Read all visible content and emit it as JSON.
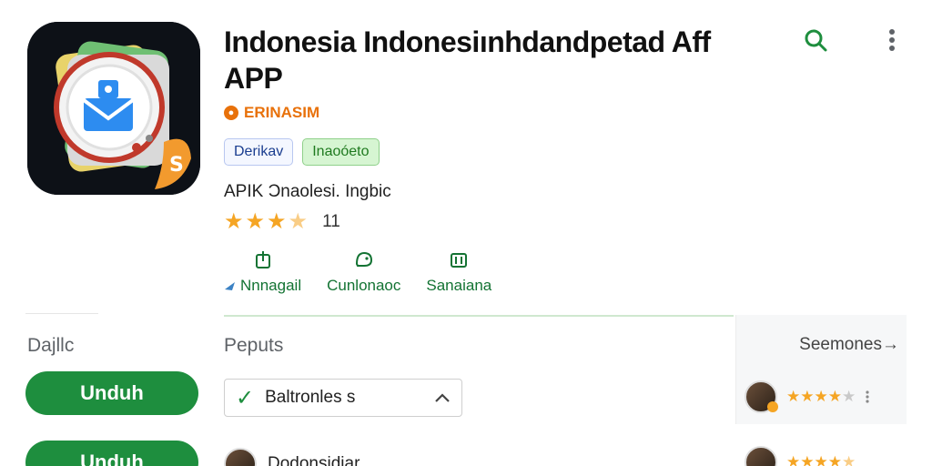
{
  "app": {
    "title": "Indonesia Indonesiınhdandpetad Aff APP",
    "developer": "ERINASIM",
    "chips": [
      "Derikav",
      "Inaoóeto"
    ],
    "meta": "APIK Ɔnaolesi. Ingbic",
    "rating": {
      "value": 3.5,
      "count": "11"
    }
  },
  "header_icons": [
    "search-icon",
    "more-vert-icon"
  ],
  "actions": [
    {
      "label": "Nnnagail",
      "icon": "share-icon",
      "prefix_icon": "arrow-icon"
    },
    {
      "label": "Cunlonaoc",
      "icon": "support-icon"
    },
    {
      "label": "Sanaiana",
      "icon": "library-icon"
    }
  ],
  "sidebar": {
    "label": "Dajllc",
    "install_buttons": [
      "Unduh",
      "Unduh"
    ]
  },
  "main": {
    "section_title": "Peputs",
    "dropdown_value": "Baltronles s",
    "review_author": "Dodonsidiar"
  },
  "side_panel": {
    "see_more": "Seemones",
    "mini_ratings": [
      4,
      4.5
    ]
  },
  "colors": {
    "accent": "#1e8e3e",
    "developer": "#e8710a",
    "star": "#f5a524"
  }
}
